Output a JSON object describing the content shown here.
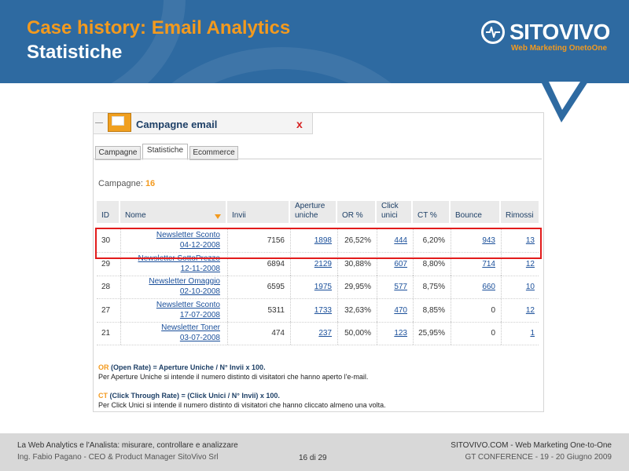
{
  "header": {
    "title_line1": "Case history: Email Analytics",
    "title_line2": "Statistiche",
    "brand_name": "SITOVIVO",
    "brand_tagline": "Web Marketing OnetoOne"
  },
  "panel": {
    "title": "Campagne email",
    "close_label": "x",
    "tabs": [
      {
        "label": "Campagne"
      },
      {
        "label": "Statistiche"
      },
      {
        "label": "Ecommerce"
      }
    ],
    "active_tab": "Statistiche",
    "campaigns_label": "Campagne:",
    "campaigns_count": "16"
  },
  "table": {
    "headers": {
      "id": "ID",
      "nome": "Nome",
      "invii": "Invii",
      "aperture_1": "Aperture",
      "aperture_2": "uniche",
      "or": "OR %",
      "click_1": "Click",
      "click_2": "unici",
      "ct": "CT %",
      "bounce": "Bounce",
      "rimossi": "Rimossi"
    },
    "rows": [
      {
        "id": "30",
        "name": "Newsletter Sconto",
        "date": "04-12-2008",
        "invii": "7156",
        "aperture": "1898",
        "or": "26,52%",
        "click": "444",
        "ct": "6,20%",
        "bounce": "943",
        "rimossi": "13"
      },
      {
        "id": "29",
        "name": "Newsletter SottoPrezzo",
        "date": "12-11-2008",
        "invii": "6894",
        "aperture": "2129",
        "or": "30,88%",
        "click": "607",
        "ct": "8,80%",
        "bounce": "714",
        "rimossi": "12"
      },
      {
        "id": "28",
        "name": "Newsletter Omaggio",
        "date": "02-10-2008",
        "invii": "6595",
        "aperture": "1975",
        "or": "29,95%",
        "click": "577",
        "ct": "8,75%",
        "bounce": "660",
        "rimossi": "10"
      },
      {
        "id": "27",
        "name": "Newsletter Sconto",
        "date": "17-07-2008",
        "invii": "5311",
        "aperture": "1733",
        "or": "32,63%",
        "click": "470",
        "ct": "8,85%",
        "bounce": "0",
        "rimossi": "12"
      },
      {
        "id": "21",
        "name": "Newsletter Toner",
        "date": "03-07-2008",
        "invii": "474",
        "aperture": "237",
        "or": "50,00%",
        "click": "123",
        "ct": "25,95%",
        "bounce": "0",
        "rimossi": "1"
      }
    ]
  },
  "notes": {
    "or_key": "OR",
    "or_formula": " (Open Rate) = Aperture Uniche / N° Invii x 100.",
    "or_desc": "Per Aperture Uniche si intende il numero distinto di visitatori che hanno aperto l'e-mail.",
    "ct_key": "CT",
    "ct_formula": " (Click Through Rate) = (Click Unici / N° Invii) x 100.",
    "ct_desc": "Per Click Unici si intende il numero distinto di visitatori che hanno cliccato almeno una volta."
  },
  "footer": {
    "left_line1": "La Web Analytics e l'Analista: misurare, controllare e analizzare",
    "left_line2": "Ing. Fabio Pagano - CEO & Product Manager SitoVivo Srl",
    "page": "16 di 29",
    "right_line1": "SITOVIVO.COM - Web Marketing One-to-One",
    "right_line2": "GT CONFERENCE - 19 - 20 Giugno 2009"
  },
  "colors": {
    "header_blue": "#2e6aa1",
    "accent_orange": "#f39a1e",
    "highlight_red": "#e21b1b",
    "link_blue": "#1a4f9a"
  }
}
